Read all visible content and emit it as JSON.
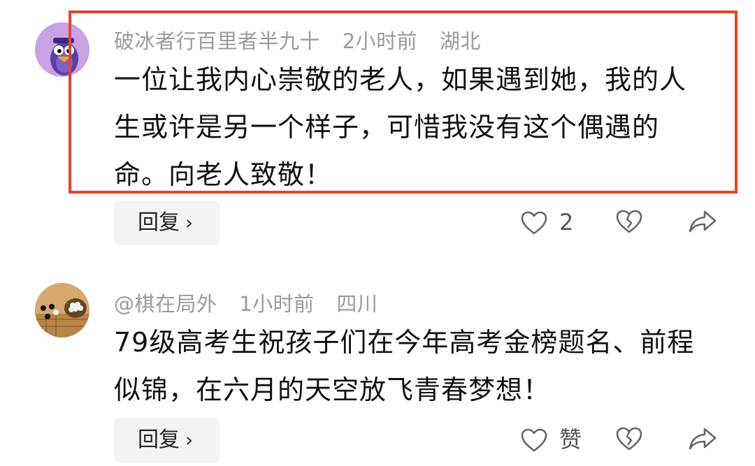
{
  "comments": [
    {
      "username": "破冰者行百里者半九十",
      "time": "2小时前",
      "location": "湖北",
      "text": "一位让我内心崇敬的老人，如果遇到她，我的人生或许是另一个样子，可惜我没有这个偶遇的命。向老人致敬！",
      "reply_label": "回复",
      "like_text": "2",
      "highlighted": true,
      "avatar_icon": "cartoon-penguin-avatar"
    },
    {
      "username": "@棋在局外",
      "time": "1小时前",
      "location": "四川",
      "text": "79级高考生祝孩子们在今年高考金榜题名、前程似锦，在六月的天空放飞青春梦想！",
      "reply_label": "回复",
      "like_text": "赞",
      "highlighted": false,
      "avatar_icon": "go-board-avatar"
    }
  ],
  "colors": {
    "highlight_border": "#e2452e",
    "meta_text": "#9a9a9a",
    "body_text": "#111111",
    "reply_bg": "#f3f3f3",
    "icon_stroke": "#666666"
  }
}
